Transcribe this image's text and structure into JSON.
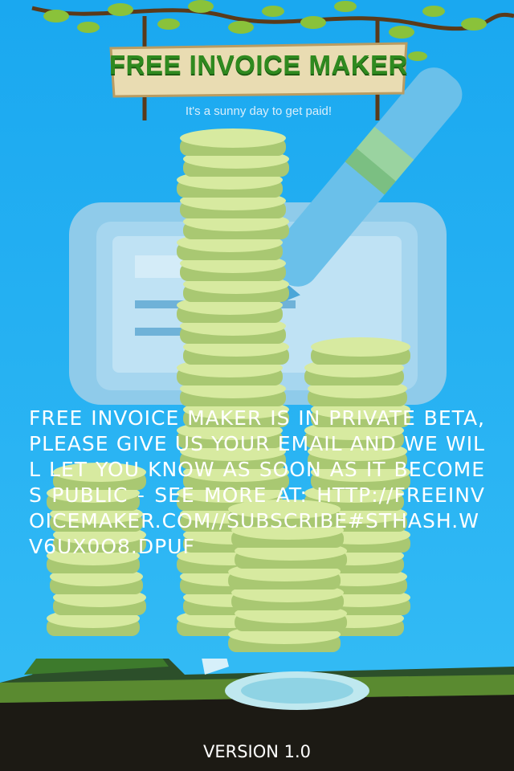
{
  "header": {
    "title": "FREE INVOICE MAKER",
    "tagline": "It's a sunny day to get paid!"
  },
  "message": {
    "text": "Free invoice maker is in private beta, please give us your email and we will let you know as soon as it becomes public - See more at: http://freeinvoicemaker.com//subscribe#sthash.Wv6UX0O8.dpuf"
  },
  "footer": {
    "version": "VERSION 1.0"
  },
  "colors": {
    "sky": "#1aa8f0",
    "title_green": "#2f8a1f",
    "coin": "#c8e08a",
    "text": "#ffffff"
  }
}
